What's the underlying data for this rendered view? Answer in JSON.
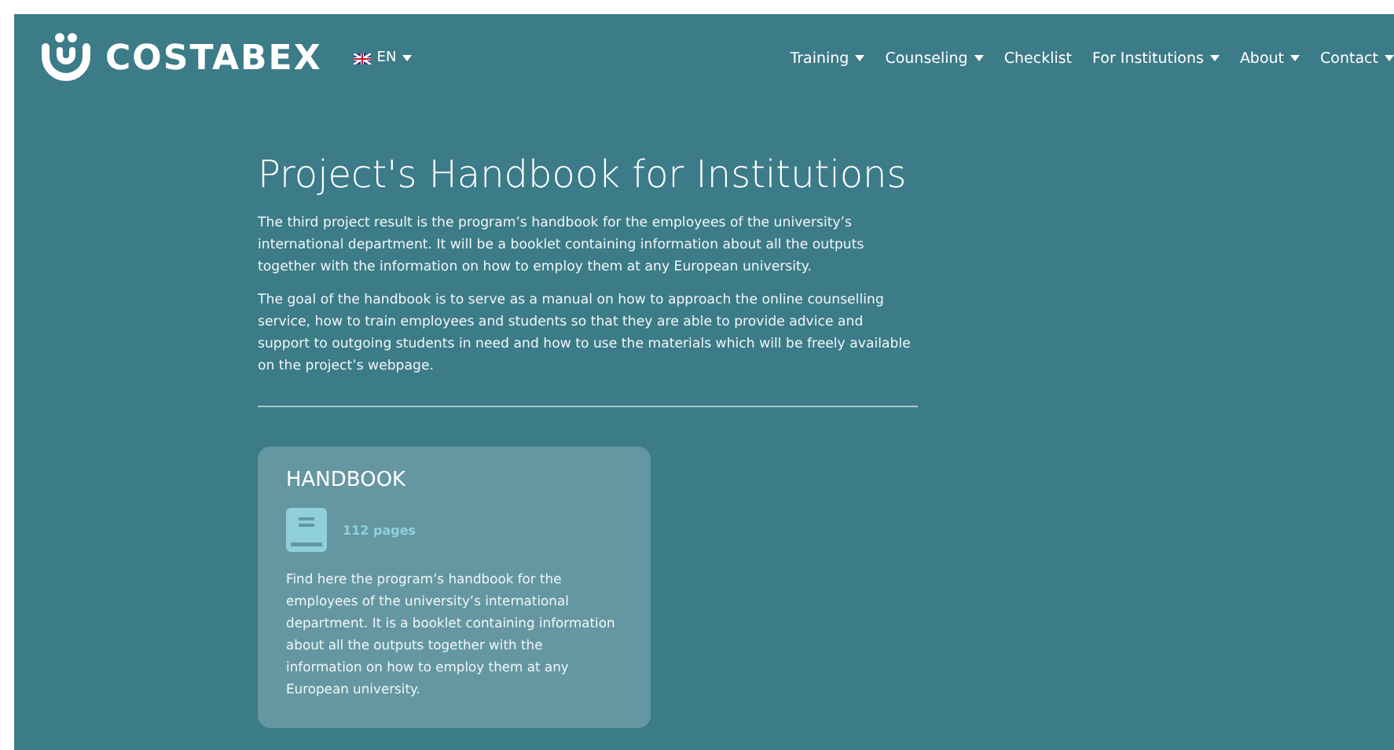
{
  "header": {
    "logo": "COSTABEX",
    "language": {
      "label": "EN",
      "dropdown": true
    },
    "nav": [
      {
        "label": "Training",
        "dropdown": true
      },
      {
        "label": "Counseling",
        "dropdown": true
      },
      {
        "label": "Checklist",
        "dropdown": false
      },
      {
        "label": "For Institutions",
        "dropdown": true
      },
      {
        "label": "About",
        "dropdown": true
      },
      {
        "label": "Contact",
        "dropdown": true
      }
    ]
  },
  "main": {
    "title": "Project's Handbook for Institutions",
    "paragraphs": [
      "The third project result is the program’s handbook for the employees of the university’s international department. It will be a booklet containing information about all the outputs together with the information on how to employ them at any European university.",
      "The goal of the handbook is to serve as a manual on how to approach the online counselling service, how to train employees and students so that they are able to provide advice and support to outgoing students in need and how to use the materials which will be freely available on the project’s webpage."
    ],
    "card": {
      "title": "HANDBOOK",
      "pages": "112 pages",
      "description": "Find here the program’s handbook for the employees of the university’s international department. It is a booklet containing information about all the outputs together with the information on how to employ them at any European university."
    }
  }
}
